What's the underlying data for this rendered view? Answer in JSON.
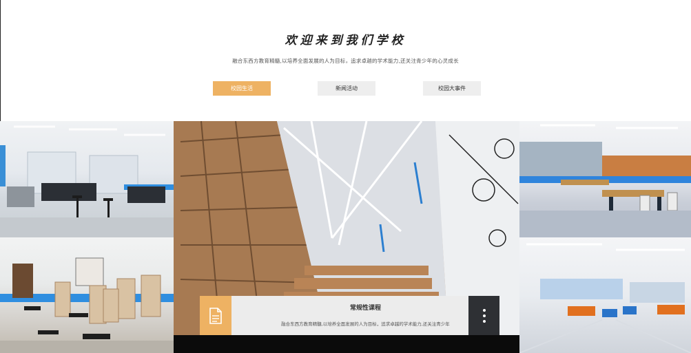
{
  "header": {
    "title": "欢迎来到我们学校",
    "subtitle": "融合东西方教育精髓,以培养全面发展的人为目标，追求卓越的学术能力,还关注青少年的心灵成长"
  },
  "tabs": [
    {
      "label": "校园生活",
      "active": true
    },
    {
      "label": "新闻活动",
      "active": false
    },
    {
      "label": "校园大事件",
      "active": false
    }
  ],
  "colors": {
    "accent": "#eeb263",
    "tab_inactive": "#eeeeee",
    "caption_bg": "#ececec",
    "more_bg": "#2e3034"
  },
  "gallery": {
    "caption": {
      "icon": "document-icon",
      "title": "常规性课程",
      "description": "融合东西方教育精髓,以培养全面发展的人为目标，追求卓越的学术能力,还关注青少年",
      "more_icon": "more-vertical-icon"
    }
  }
}
